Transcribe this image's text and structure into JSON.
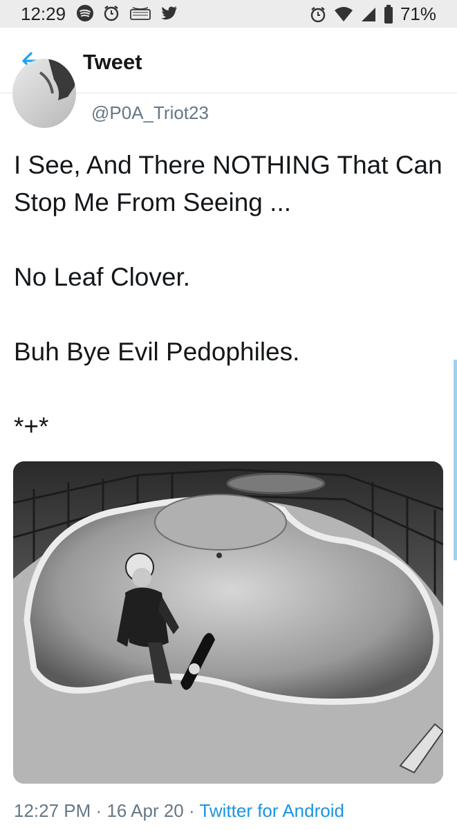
{
  "status_bar": {
    "time": "12:29",
    "battery": "71%",
    "icons": [
      "spotify-icon",
      "alarm-icon",
      "amazon-icon",
      "twitter-bird-icon",
      "alarm-icon",
      "wifi-icon",
      "signal-icon",
      "battery-icon"
    ]
  },
  "header": {
    "title": "Tweet",
    "back_icon": "arrow-left-icon"
  },
  "tweet": {
    "handle": "@P0A_Triot23",
    "lines": [
      "I See, And There NOTHING That Can Stop Me From Seeing  ...",
      "No Leaf Clover.",
      "Buh Bye Evil Pedophiles.",
      "*+*"
    ],
    "time": "12:27 PM",
    "separator": "·",
    "date": "16 Apr 20",
    "source": "Twitter for Android"
  },
  "colors": {
    "accent": "#1da1f2",
    "text": "#14171a",
    "secondary": "#657786"
  }
}
